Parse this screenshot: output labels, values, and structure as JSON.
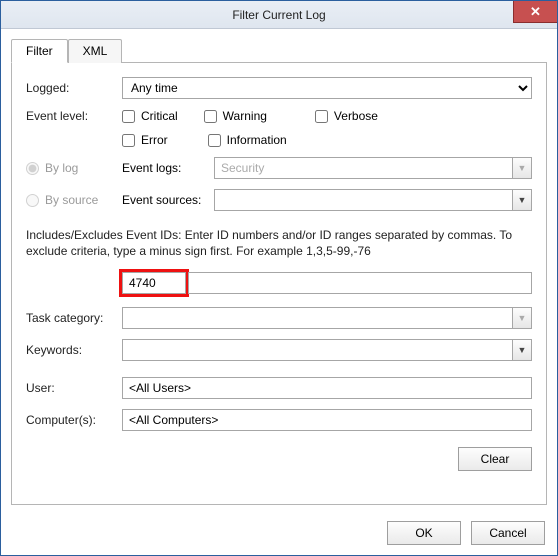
{
  "title": "Filter Current Log",
  "close_glyph": "✕",
  "tabs": {
    "filter": "Filter",
    "xml": "XML"
  },
  "labels": {
    "logged": "Logged:",
    "event_level": "Event level:",
    "by_log": "By log",
    "by_source": "By source",
    "event_logs": "Event logs:",
    "event_sources": "Event sources:",
    "task_category": "Task category:",
    "keywords": "Keywords:",
    "user": "User:",
    "computers": "Computer(s):"
  },
  "logged_options": [
    "Any time"
  ],
  "logged_selected": "Any time",
  "level_checks": {
    "critical": "Critical",
    "warning": "Warning",
    "verbose": "Verbose",
    "error": "Error",
    "information": "Information"
  },
  "event_logs_value": "Security",
  "event_sources_value": "",
  "help_text": "Includes/Excludes Event IDs: Enter ID numbers and/or ID ranges separated by commas. To exclude criteria, type a minus sign first. For example 1,3,5-99,-76",
  "event_id_value": "4740",
  "user_value": "<All Users>",
  "computers_value": "<All Computers>",
  "buttons": {
    "clear": "Clear",
    "ok": "OK",
    "cancel": "Cancel"
  }
}
